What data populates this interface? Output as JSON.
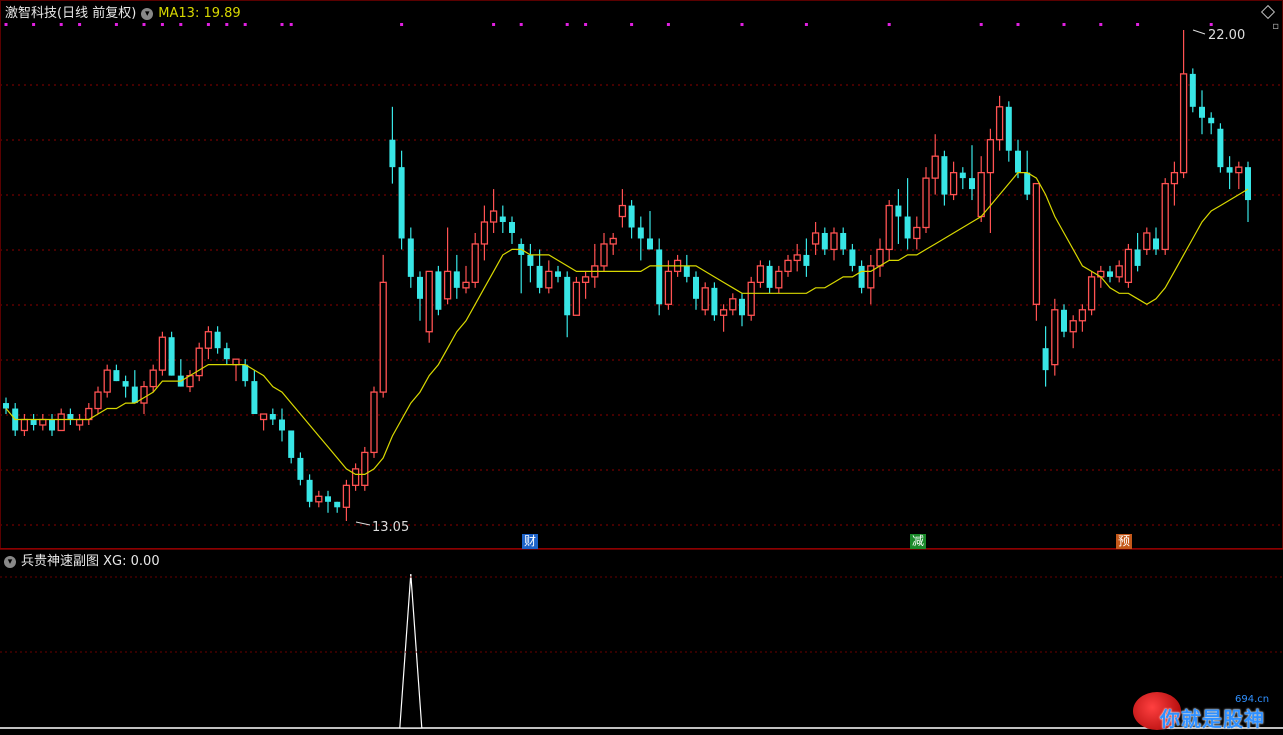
{
  "header": {
    "stock_name": "激智科技",
    "period_mode": "(日线 前复权)",
    "ma_label": "MA13:",
    "ma_value": "19.89"
  },
  "sub_header": {
    "indicator_name": "兵贵神速副图",
    "xg_label": "XG:",
    "xg_value": "0.00"
  },
  "markers": {
    "badges": [
      "财",
      "减",
      "预"
    ]
  },
  "watermark": {
    "text": "你就是股神",
    "site": "694.cn"
  },
  "colors": {
    "up": "#ff5252",
    "down": "#38e6e6",
    "ma": "#d8d800",
    "signal_dot": "#e020e0",
    "grid": "#8b0000",
    "badge_blue": "#1e63c8",
    "badge_green": "#1a8a2a",
    "badge_orange": "#c4581a"
  },
  "chart_data": {
    "type": "candlestick",
    "title": "激智科技",
    "ylim": [
      12.5,
      22.5
    ],
    "high_annotation": "22.00",
    "low_annotation": "13.05",
    "ohlc": [
      [
        15.2,
        15.3,
        15.0,
        15.1
      ],
      [
        15.1,
        15.2,
        14.6,
        14.7
      ],
      [
        14.7,
        15.0,
        14.6,
        14.9
      ],
      [
        14.9,
        15.0,
        14.7,
        14.8
      ],
      [
        14.8,
        15.0,
        14.7,
        14.9
      ],
      [
        14.9,
        15.0,
        14.6,
        14.7
      ],
      [
        14.7,
        15.1,
        14.7,
        15.0
      ],
      [
        15.0,
        15.1,
        14.8,
        14.9
      ],
      [
        14.8,
        15.0,
        14.7,
        14.9
      ],
      [
        14.9,
        15.2,
        14.8,
        15.1
      ],
      [
        15.1,
        15.5,
        15.0,
        15.4
      ],
      [
        15.4,
        15.9,
        15.3,
        15.8
      ],
      [
        15.8,
        15.9,
        15.6,
        15.6
      ],
      [
        15.6,
        15.7,
        15.3,
        15.5
      ],
      [
        15.5,
        15.8,
        15.2,
        15.2
      ],
      [
        15.2,
        15.6,
        15.0,
        15.5
      ],
      [
        15.5,
        15.9,
        15.4,
        15.8
      ],
      [
        15.8,
        16.5,
        15.7,
        16.4
      ],
      [
        16.4,
        16.5,
        15.7,
        15.7
      ],
      [
        15.7,
        16.0,
        15.5,
        15.5
      ],
      [
        15.5,
        15.8,
        15.4,
        15.7
      ],
      [
        15.7,
        16.3,
        15.6,
        16.2
      ],
      [
        16.2,
        16.6,
        16.0,
        16.5
      ],
      [
        16.5,
        16.6,
        16.1,
        16.2
      ],
      [
        16.2,
        16.3,
        15.9,
        16.0
      ],
      [
        15.9,
        16.0,
        15.6,
        16.0
      ],
      [
        15.9,
        16.0,
        15.5,
        15.6
      ],
      [
        15.6,
        15.8,
        15.0,
        15.0
      ],
      [
        14.9,
        15.0,
        14.7,
        15.0
      ],
      [
        15.0,
        15.1,
        14.8,
        14.9
      ],
      [
        14.9,
        15.1,
        14.5,
        14.7
      ],
      [
        14.7,
        14.7,
        14.1,
        14.2
      ],
      [
        14.2,
        14.3,
        13.7,
        13.8
      ],
      [
        13.8,
        13.9,
        13.3,
        13.4
      ],
      [
        13.4,
        13.6,
        13.3,
        13.5
      ],
      [
        13.5,
        13.6,
        13.2,
        13.4
      ],
      [
        13.4,
        13.4,
        13.2,
        13.3
      ],
      [
        13.3,
        13.8,
        13.05,
        13.7
      ],
      [
        13.7,
        14.1,
        13.6,
        14.0
      ],
      [
        13.7,
        14.4,
        13.6,
        14.3
      ],
      [
        14.3,
        15.5,
        14.2,
        15.4
      ],
      [
        15.4,
        17.9,
        15.3,
        17.4
      ],
      [
        20.0,
        20.6,
        19.2,
        19.5
      ],
      [
        19.5,
        19.8,
        18.0,
        18.2
      ],
      [
        18.2,
        18.4,
        17.3,
        17.5
      ],
      [
        17.5,
        17.6,
        16.7,
        17.1
      ],
      [
        16.5,
        17.6,
        16.3,
        17.6
      ],
      [
        17.6,
        17.7,
        16.8,
        16.9
      ],
      [
        17.1,
        18.4,
        17.0,
        17.6
      ],
      [
        17.6,
        17.9,
        17.1,
        17.3
      ],
      [
        17.3,
        17.7,
        17.2,
        17.4
      ],
      [
        17.4,
        18.3,
        17.3,
        18.1
      ],
      [
        18.1,
        18.8,
        17.8,
        18.5
      ],
      [
        18.5,
        19.1,
        18.3,
        18.7
      ],
      [
        18.6,
        18.8,
        18.3,
        18.5
      ],
      [
        18.5,
        18.6,
        18.1,
        18.3
      ],
      [
        18.1,
        18.2,
        17.2,
        17.9
      ],
      [
        17.9,
        18.1,
        17.4,
        17.7
      ],
      [
        17.7,
        18.0,
        17.2,
        17.3
      ],
      [
        17.3,
        17.8,
        17.2,
        17.6
      ],
      [
        17.6,
        17.7,
        17.4,
        17.5
      ],
      [
        17.5,
        17.6,
        16.4,
        16.8
      ],
      [
        16.8,
        17.5,
        16.8,
        17.4
      ],
      [
        17.4,
        17.6,
        17.1,
        17.5
      ],
      [
        17.5,
        18.1,
        17.3,
        17.7
      ],
      [
        17.7,
        18.3,
        17.6,
        18.1
      ],
      [
        18.1,
        18.3,
        17.9,
        18.2
      ],
      [
        18.6,
        19.1,
        18.4,
        18.8
      ],
      [
        18.8,
        18.9,
        18.2,
        18.4
      ],
      [
        18.4,
        18.6,
        17.8,
        18.2
      ],
      [
        18.2,
        18.7,
        18.0,
        18.0
      ],
      [
        18.0,
        18.2,
        16.8,
        17.0
      ],
      [
        17.0,
        17.8,
        16.9,
        17.6
      ],
      [
        17.6,
        17.9,
        17.5,
        17.8
      ],
      [
        17.7,
        17.9,
        17.4,
        17.5
      ],
      [
        17.5,
        17.6,
        16.9,
        17.1
      ],
      [
        16.9,
        17.4,
        16.8,
        17.3
      ],
      [
        17.3,
        17.4,
        16.7,
        16.8
      ],
      [
        16.8,
        17.0,
        16.5,
        16.9
      ],
      [
        16.9,
        17.2,
        16.8,
        17.1
      ],
      [
        17.1,
        17.2,
        16.6,
        16.8
      ],
      [
        16.8,
        17.5,
        16.7,
        17.4
      ],
      [
        17.4,
        17.8,
        17.3,
        17.7
      ],
      [
        17.7,
        17.8,
        17.2,
        17.3
      ],
      [
        17.3,
        17.7,
        17.2,
        17.6
      ],
      [
        17.6,
        17.9,
        17.5,
        17.8
      ],
      [
        17.8,
        18.1,
        17.6,
        17.9
      ],
      [
        17.9,
        18.2,
        17.5,
        17.7
      ],
      [
        18.1,
        18.5,
        17.9,
        18.3
      ],
      [
        18.3,
        18.4,
        17.9,
        18.0
      ],
      [
        18.0,
        18.4,
        17.8,
        18.3
      ],
      [
        18.3,
        18.4,
        17.9,
        18.0
      ],
      [
        18.0,
        18.1,
        17.6,
        17.7
      ],
      [
        17.7,
        17.8,
        17.2,
        17.3
      ],
      [
        17.3,
        17.9,
        17.0,
        17.7
      ],
      [
        17.7,
        18.2,
        17.5,
        18.0
      ],
      [
        18.0,
        18.9,
        17.8,
        18.8
      ],
      [
        18.8,
        19.1,
        18.1,
        18.6
      ],
      [
        18.6,
        19.3,
        18.0,
        18.2
      ],
      [
        18.2,
        18.6,
        18.0,
        18.4
      ],
      [
        18.4,
        19.5,
        18.3,
        19.3
      ],
      [
        19.3,
        20.1,
        19.0,
        19.7
      ],
      [
        19.7,
        19.8,
        18.8,
        19.0
      ],
      [
        19.0,
        19.6,
        18.9,
        19.4
      ],
      [
        19.4,
        19.5,
        19.1,
        19.3
      ],
      [
        19.3,
        19.9,
        18.9,
        19.1
      ],
      [
        18.6,
        19.7,
        18.5,
        19.4
      ],
      [
        19.4,
        20.2,
        18.3,
        20.0
      ],
      [
        20.0,
        20.8,
        19.8,
        20.6
      ],
      [
        20.6,
        20.7,
        19.6,
        19.8
      ],
      [
        19.8,
        20.0,
        19.3,
        19.4
      ],
      [
        19.4,
        19.8,
        18.9,
        19.0
      ],
      [
        17.0,
        19.2,
        16.7,
        19.2
      ],
      [
        16.2,
        16.6,
        15.5,
        15.8
      ],
      [
        15.9,
        17.1,
        15.7,
        16.9
      ],
      [
        16.9,
        17.0,
        16.4,
        16.5
      ],
      [
        16.5,
        16.8,
        16.2,
        16.7
      ],
      [
        16.7,
        17.0,
        16.5,
        16.9
      ],
      [
        16.9,
        17.6,
        16.8,
        17.5
      ],
      [
        17.5,
        17.7,
        17.3,
        17.6
      ],
      [
        17.6,
        17.7,
        17.4,
        17.5
      ],
      [
        17.5,
        17.8,
        17.4,
        17.7
      ],
      [
        17.4,
        18.1,
        17.3,
        18.0
      ],
      [
        18.0,
        18.3,
        17.6,
        17.7
      ],
      [
        18.0,
        18.4,
        17.9,
        18.3
      ],
      [
        18.2,
        18.4,
        17.9,
        18.0
      ],
      [
        18.0,
        19.3,
        17.9,
        19.2
      ],
      [
        19.2,
        19.6,
        18.8,
        19.4
      ],
      [
        19.4,
        22.0,
        19.3,
        21.2
      ],
      [
        21.2,
        21.3,
        20.5,
        20.6
      ],
      [
        20.6,
        20.9,
        20.1,
        20.4
      ],
      [
        20.4,
        20.5,
        20.1,
        20.3
      ],
      [
        20.2,
        20.3,
        19.4,
        19.5
      ],
      [
        19.5,
        19.7,
        19.1,
        19.4
      ],
      [
        19.4,
        19.6,
        19.1,
        19.5
      ],
      [
        19.5,
        19.6,
        18.5,
        18.9
      ]
    ],
    "ma13": [
      15.1,
      14.9,
      14.9,
      14.9,
      14.9,
      14.9,
      14.9,
      14.9,
      14.9,
      14.9,
      15.0,
      15.1,
      15.1,
      15.2,
      15.2,
      15.3,
      15.4,
      15.6,
      15.6,
      15.6,
      15.7,
      15.8,
      15.9,
      15.9,
      15.9,
      15.9,
      15.9,
      15.8,
      15.7,
      15.5,
      15.4,
      15.2,
      15.0,
      14.8,
      14.6,
      14.4,
      14.2,
      14.0,
      13.9,
      13.9,
      14.0,
      14.2,
      14.6,
      14.9,
      15.2,
      15.4,
      15.7,
      15.9,
      16.2,
      16.5,
      16.7,
      17.0,
      17.3,
      17.6,
      17.9,
      18.0,
      18.0,
      17.9,
      17.9,
      17.9,
      17.8,
      17.7,
      17.6,
      17.6,
      17.6,
      17.6,
      17.6,
      17.6,
      17.6,
      17.6,
      17.7,
      17.7,
      17.7,
      17.7,
      17.7,
      17.7,
      17.6,
      17.5,
      17.4,
      17.3,
      17.2,
      17.2,
      17.2,
      17.2,
      17.2,
      17.2,
      17.2,
      17.2,
      17.3,
      17.3,
      17.4,
      17.5,
      17.5,
      17.6,
      17.6,
      17.7,
      17.8,
      17.8,
      17.9,
      17.9,
      18.0,
      18.1,
      18.2,
      18.3,
      18.4,
      18.5,
      18.6,
      18.8,
      19.0,
      19.2,
      19.4,
      19.4,
      19.3,
      19.0,
      18.6,
      18.3,
      18.0,
      17.7,
      17.6,
      17.5,
      17.3,
      17.2,
      17.2,
      17.1,
      17.0,
      17.1,
      17.3,
      17.6,
      17.9,
      18.2,
      18.5,
      18.7,
      18.8,
      18.9,
      19.0,
      19.1
    ],
    "xg_values": {
      "count": 136,
      "signal_index": 44,
      "signal_value": 1,
      "baseline": 0
    },
    "signal_dots_at": [
      0,
      3,
      6,
      8,
      12,
      15,
      17,
      19,
      22,
      24,
      26,
      30,
      31,
      43,
      53,
      56,
      61,
      63,
      68,
      72,
      80,
      87,
      96,
      106,
      110,
      115,
      119,
      123,
      131
    ]
  }
}
